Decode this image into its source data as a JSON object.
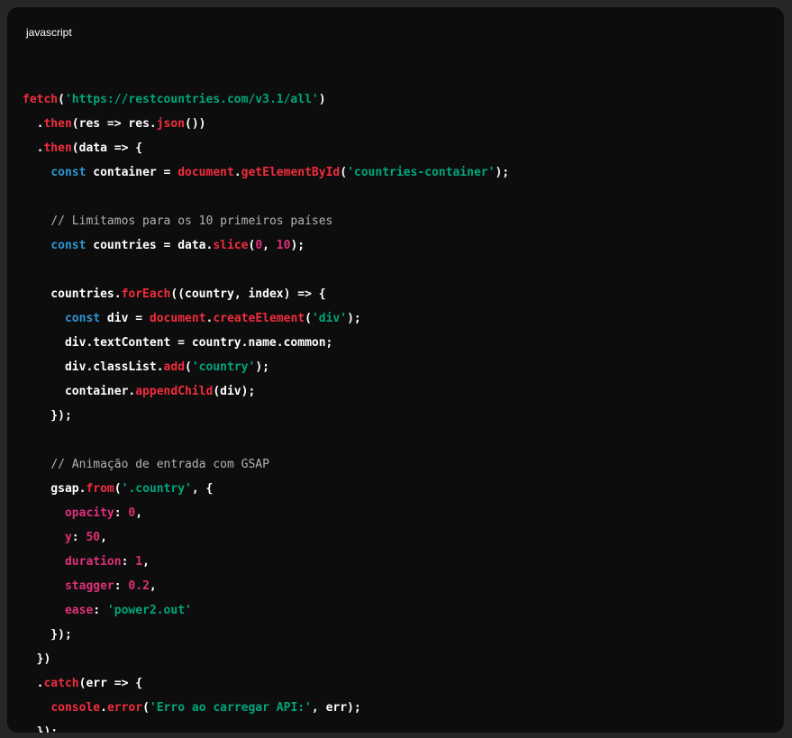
{
  "code_block": {
    "language": "javascript",
    "colors": {
      "background": "#0d0d0d",
      "plain": "#ffffff",
      "keyword": "#2e95d3",
      "method": "#f22c3d",
      "string": "#00a67d",
      "number": "#df3079",
      "comment": "#b3b3b3"
    },
    "lines": [
      [],
      [
        [
          "method",
          "fetch"
        ],
        [
          "plain",
          "("
        ],
        [
          "string",
          "'https://restcountries.com/v3.1/all'"
        ],
        [
          "plain",
          ")"
        ]
      ],
      [
        [
          "plain",
          "  ."
        ],
        [
          "method",
          "then"
        ],
        [
          "plain",
          "(res => res."
        ],
        [
          "method",
          "json"
        ],
        [
          "plain",
          "())"
        ]
      ],
      [
        [
          "plain",
          "  ."
        ],
        [
          "method",
          "then"
        ],
        [
          "plain",
          "(data => {"
        ]
      ],
      [
        [
          "plain",
          "    "
        ],
        [
          "keyword",
          "const"
        ],
        [
          "plain",
          " container = "
        ],
        [
          "method",
          "document"
        ],
        [
          "plain",
          "."
        ],
        [
          "method",
          "getElementById"
        ],
        [
          "plain",
          "("
        ],
        [
          "string",
          "'countries-container'"
        ],
        [
          "plain",
          ");"
        ]
      ],
      [],
      [
        [
          "plain",
          "    "
        ],
        [
          "comment",
          "// Limitamos para os 10 primeiros países"
        ]
      ],
      [
        [
          "plain",
          "    "
        ],
        [
          "keyword",
          "const"
        ],
        [
          "plain",
          " countries = data."
        ],
        [
          "method",
          "slice"
        ],
        [
          "plain",
          "("
        ],
        [
          "number",
          "0"
        ],
        [
          "plain",
          ", "
        ],
        [
          "number",
          "10"
        ],
        [
          "plain",
          ");"
        ]
      ],
      [],
      [
        [
          "plain",
          "    countries."
        ],
        [
          "method",
          "forEach"
        ],
        [
          "plain",
          "((country, index) => {"
        ]
      ],
      [
        [
          "plain",
          "      "
        ],
        [
          "keyword",
          "const"
        ],
        [
          "plain",
          " div = "
        ],
        [
          "method",
          "document"
        ],
        [
          "plain",
          "."
        ],
        [
          "method",
          "createElement"
        ],
        [
          "plain",
          "("
        ],
        [
          "string",
          "'div'"
        ],
        [
          "plain",
          ");"
        ]
      ],
      [
        [
          "plain",
          "      div.textContent = country.name.common;"
        ]
      ],
      [
        [
          "plain",
          "      div.classList."
        ],
        [
          "method",
          "add"
        ],
        [
          "plain",
          "("
        ],
        [
          "string",
          "'country'"
        ],
        [
          "plain",
          ");"
        ]
      ],
      [
        [
          "plain",
          "      container."
        ],
        [
          "method",
          "appendChild"
        ],
        [
          "plain",
          "(div);"
        ]
      ],
      [
        [
          "plain",
          "    });"
        ]
      ],
      [],
      [
        [
          "plain",
          "    "
        ],
        [
          "comment",
          "// Animação de entrada com GSAP"
        ]
      ],
      [
        [
          "plain",
          "    gsap."
        ],
        [
          "method",
          "from"
        ],
        [
          "plain",
          "("
        ],
        [
          "string",
          "'.country'"
        ],
        [
          "plain",
          ", {"
        ]
      ],
      [
        [
          "plain",
          "      "
        ],
        [
          "prop",
          "opacity"
        ],
        [
          "plain",
          ": "
        ],
        [
          "number",
          "0"
        ],
        [
          "plain",
          ","
        ]
      ],
      [
        [
          "plain",
          "      "
        ],
        [
          "prop",
          "y"
        ],
        [
          "plain",
          ": "
        ],
        [
          "number",
          "50"
        ],
        [
          "plain",
          ","
        ]
      ],
      [
        [
          "plain",
          "      "
        ],
        [
          "prop",
          "duration"
        ],
        [
          "plain",
          ": "
        ],
        [
          "number",
          "1"
        ],
        [
          "plain",
          ","
        ]
      ],
      [
        [
          "plain",
          "      "
        ],
        [
          "prop",
          "stagger"
        ],
        [
          "plain",
          ": "
        ],
        [
          "number",
          "0.2"
        ],
        [
          "plain",
          ","
        ]
      ],
      [
        [
          "plain",
          "      "
        ],
        [
          "prop",
          "ease"
        ],
        [
          "plain",
          ": "
        ],
        [
          "string",
          "'power2.out'"
        ]
      ],
      [
        [
          "plain",
          "    });"
        ]
      ],
      [
        [
          "plain",
          "  })"
        ]
      ],
      [
        [
          "plain",
          "  ."
        ],
        [
          "method",
          "catch"
        ],
        [
          "plain",
          "(err => {"
        ]
      ],
      [
        [
          "plain",
          "    "
        ],
        [
          "method",
          "console"
        ],
        [
          "plain",
          "."
        ],
        [
          "method",
          "error"
        ],
        [
          "plain",
          "("
        ],
        [
          "string",
          "'Erro ao carregar API:'"
        ],
        [
          "plain",
          ", err);"
        ]
      ],
      [
        [
          "plain",
          "  });"
        ]
      ]
    ]
  }
}
